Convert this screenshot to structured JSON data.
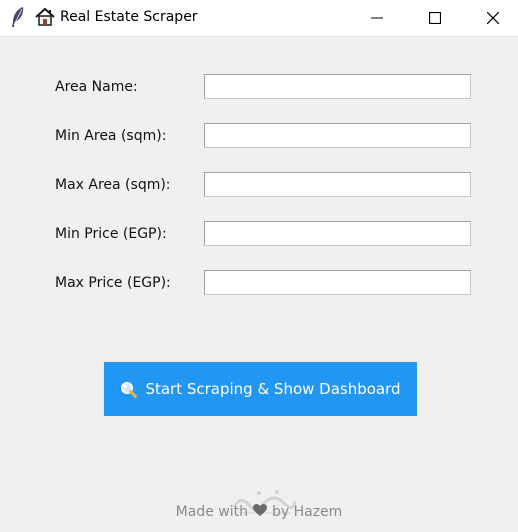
{
  "window": {
    "title": "Real Estate Scraper",
    "icons": [
      "feather-icon",
      "house-icon"
    ],
    "controls": [
      "minimize-icon",
      "maximize-icon",
      "close-icon"
    ]
  },
  "form": {
    "fields": [
      {
        "label": "Area Name:",
        "value": ""
      },
      {
        "label": "Min Area (sqm):",
        "value": ""
      },
      {
        "label": "Max Area (sqm):",
        "value": ""
      },
      {
        "label": "Min Price (EGP):",
        "value": ""
      },
      {
        "label": "Max Price (EGP):",
        "value": ""
      }
    ]
  },
  "actions": {
    "start_label": "Start Scraping & Show Dashboard",
    "start_icon": "magnifier-icon",
    "start_color": "#2196f3"
  },
  "footer": {
    "prefix": "Made with",
    "icon": "heart-icon",
    "suffix": "by Hazem"
  },
  "colors": {
    "background": "#f0f0f0",
    "titlebar": "#ffffff",
    "footer_text": "#8a8a8a"
  }
}
